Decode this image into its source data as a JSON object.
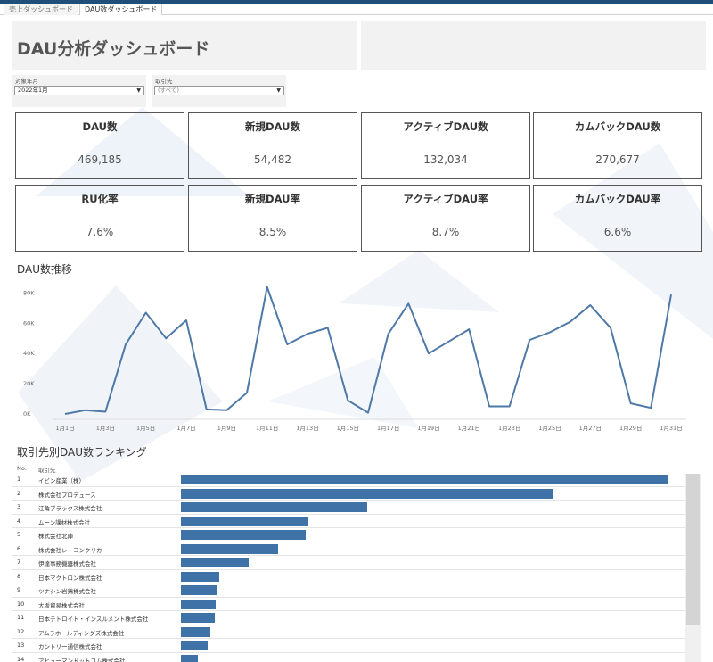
{
  "tabs": [
    {
      "label": "売上ダッシュボード",
      "active": false
    },
    {
      "label": "DAU数ダッシュボード",
      "active": true
    }
  ],
  "header": {
    "title": "DAU分析ダッシュボード"
  },
  "filters": {
    "month": {
      "label": "対象年月",
      "value": "2022年1月"
    },
    "client": {
      "label": "取引先",
      "value": "(すべて)"
    }
  },
  "kpis": [
    {
      "label": "DAU数",
      "value": "469,185"
    },
    {
      "label": "新規DAU数",
      "value": "54,482"
    },
    {
      "label": "アクティブDAU数",
      "value": "132,034"
    },
    {
      "label": "カムバックDAU数",
      "value": "270,677"
    },
    {
      "label": "RU化率",
      "value": "7.6%"
    },
    {
      "label": "新規DAU率",
      "value": "8.5%"
    },
    {
      "label": "アクティブDAU率",
      "value": "8.7%"
    },
    {
      "label": "カムバックDAU率",
      "value": "6.6%"
    }
  ],
  "trend": {
    "title": "DAU数推移"
  },
  "chart_data": {
    "type": "line",
    "title": "DAU数推移",
    "xlabel": "",
    "ylabel": "",
    "ylim": [
      0,
      85000
    ],
    "ytick_values": [
      0,
      20000,
      40000,
      60000,
      80000
    ],
    "yticks": [
      "0K",
      "20K",
      "40K",
      "60K",
      "80K"
    ],
    "xticks": [
      "1月1日",
      "1月3日",
      "1月5日",
      "1月7日",
      "1月9日",
      "1月11日",
      "1月13日",
      "1月15日",
      "1月17日",
      "1月19日",
      "1月21日",
      "1月23日",
      "1月25日",
      "1月27日",
      "1月29日",
      "1月31日"
    ],
    "x": [
      1,
      2,
      3,
      4,
      5,
      6,
      7,
      8,
      9,
      10,
      11,
      12,
      13,
      14,
      15,
      16,
      17,
      18,
      19,
      20,
      21,
      22,
      23,
      24,
      25,
      26,
      27,
      28,
      29,
      30,
      31
    ],
    "values": [
      0,
      2500,
      1500,
      46000,
      67000,
      50000,
      62000,
      3000,
      2500,
      14000,
      84000,
      46000,
      53000,
      57000,
      9000,
      800,
      53000,
      73000,
      40000,
      48000,
      56000,
      5000,
      5000,
      49000,
      54000,
      61000,
      72000,
      57000,
      7000,
      4000,
      79000
    ],
    "grid": false,
    "color": "#4e79a7"
  },
  "ranking": {
    "title": "取引先別DAU数ランキング",
    "col_no": "No.",
    "col_name": "取引先",
    "bar_color": "#3f72a6",
    "rows": [
      {
        "no": "1",
        "name": "イビン産業（株）",
        "value": 1.0
      },
      {
        "no": "2",
        "name": "株式会社プロデュース",
        "value": 0.765
      },
      {
        "no": "3",
        "name": "江角ブラックス株式会社",
        "value": 0.382
      },
      {
        "no": "4",
        "name": "ムーン課材株式会社",
        "value": 0.261
      },
      {
        "no": "5",
        "name": "株式会社北陣",
        "value": 0.256
      },
      {
        "no": "6",
        "name": "株式会社レーヨンクリカー",
        "value": 0.2
      },
      {
        "no": "7",
        "name": "伊達事務機器株式会社",
        "value": 0.14
      },
      {
        "no": "8",
        "name": "日本マクトロン株式会社",
        "value": 0.079
      },
      {
        "no": "9",
        "name": "ツナシン岩鶏株式会社",
        "value": 0.073
      },
      {
        "no": "10",
        "name": "大坂貿易株式会社",
        "value": 0.071
      },
      {
        "no": "11",
        "name": "日本テトロイト・インスルメント株式会社",
        "value": 0.069
      },
      {
        "no": "12",
        "name": "アムラホールディングズ株式会社",
        "value": 0.06
      },
      {
        "no": "13",
        "name": "カントリー通信株式会社",
        "value": 0.055
      },
      {
        "no": "14",
        "name": "アヒューマンドットコム株式会社",
        "value": 0.034
      }
    ]
  }
}
